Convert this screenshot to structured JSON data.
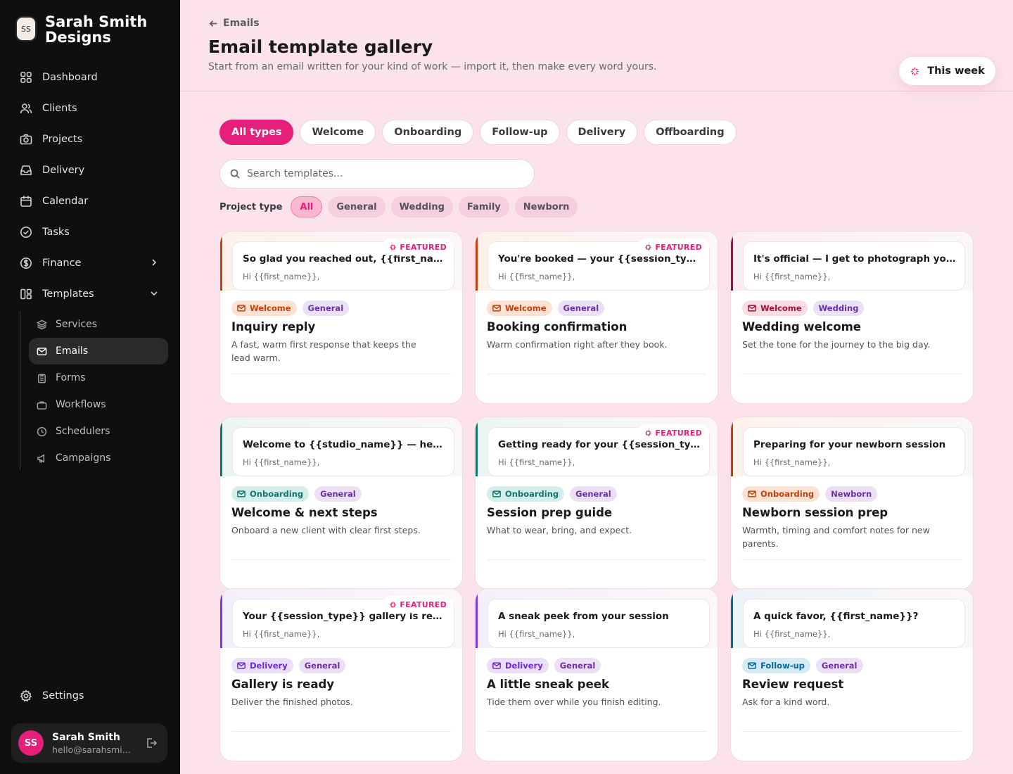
{
  "brand": {
    "initials": "SS",
    "name": "Sarah Smith Designs"
  },
  "nav": [
    {
      "label": "Dashboard",
      "icon": "grid-icon"
    },
    {
      "label": "Clients",
      "icon": "users-icon"
    },
    {
      "label": "Projects",
      "icon": "camera-icon"
    },
    {
      "label": "Delivery",
      "icon": "inbox-icon"
    },
    {
      "label": "Calendar",
      "icon": "calendar-icon"
    },
    {
      "label": "Tasks",
      "icon": "check-circle-icon"
    },
    {
      "label": "Finance",
      "icon": "dollar-icon"
    },
    {
      "label": "Templates",
      "icon": "layout-icon"
    }
  ],
  "subnav": [
    {
      "label": "Services",
      "icon": "layers-icon"
    },
    {
      "label": "Emails",
      "icon": "mail-icon"
    },
    {
      "label": "Forms",
      "icon": "clipboard-icon"
    },
    {
      "label": "Workflows",
      "icon": "briefcase-icon"
    },
    {
      "label": "Schedulers",
      "icon": "clock-icon"
    },
    {
      "label": "Campaigns",
      "icon": "megaphone-icon"
    }
  ],
  "settings": "Settings",
  "user": {
    "initials": "SS",
    "name": "Sarah Smith",
    "email": "hello@sarahsmi..."
  },
  "header": {
    "back": "Emails",
    "title": "Email template gallery",
    "subtitle": "Start from an email written for your kind of work — import it, then make every word yours.",
    "week_button": "This week"
  },
  "type_tabs": [
    "All types",
    "Welcome",
    "Onboarding",
    "Follow-up",
    "Delivery",
    "Offboarding"
  ],
  "search": {
    "placeholder": "Search templates..."
  },
  "project_type": {
    "label": "Project type",
    "chips": [
      "All",
      "General",
      "Wedding",
      "Family",
      "Newborn"
    ]
  },
  "featured_label": "FEATURED",
  "cards": [
    {
      "subject": "So glad you reached out, {{first_name}}!",
      "greeting": "Hi {{first_name}},",
      "featured": true,
      "type": "Welcome",
      "project": "General",
      "title": "Inquiry reply",
      "desc": "A fast, warm first response that keeps the lead warm.",
      "accent": "#c2410c",
      "tint": "#fdf1ea",
      "badge_bg": "#fde2d3",
      "badge_fg": "#c2410c"
    },
    {
      "subject": "You're booked — your {{session_type}} is confirmed",
      "greeting": "Hi {{first_name}},",
      "featured": true,
      "type": "Welcome",
      "project": "General",
      "title": "Booking confirmation",
      "desc": "Warm confirmation right after they book.",
      "accent": "#c2410c",
      "tint": "#fdf1ea",
      "badge_bg": "#fde2d3",
      "badge_fg": "#c2410c"
    },
    {
      "subject": "It's official — I get to photograph your wedding!",
      "greeting": "Hi {{first_name}},",
      "featured": false,
      "type": "Welcome",
      "project": "Wedding",
      "title": "Wedding welcome",
      "desc": "Set the tone for the journey to the big day.",
      "accent": "#9f1239",
      "tint": "#fbeef2",
      "badge_bg": "#fbdbe4",
      "badge_fg": "#9f1239"
    },
    {
      "subject": "Welcome to {{studio_name}} — here's what's next",
      "greeting": "Hi {{first_name}},",
      "featured": false,
      "type": "Onboarding",
      "project": "General",
      "title": "Welcome & next steps",
      "desc": "Onboard a new client with clear first steps.",
      "accent": "#0f766e",
      "tint": "#ecf5f3",
      "badge_bg": "#d4efe9",
      "badge_fg": "#0f766e"
    },
    {
      "subject": "Getting ready for your {{session_type}} session",
      "greeting": "Hi {{first_name}},",
      "featured": true,
      "type": "Onboarding",
      "project": "General",
      "title": "Session prep guide",
      "desc": "What to wear, bring, and expect.",
      "accent": "#0f766e",
      "tint": "#ecf5f3",
      "badge_bg": "#d4efe9",
      "badge_fg": "#0f766e"
    },
    {
      "subject": "Preparing for your newborn session",
      "greeting": "Hi {{first_name}},",
      "featured": false,
      "type": "Onboarding",
      "project": "Newborn",
      "title": "Newborn session prep",
      "desc": "Warmth, timing and comfort notes for new parents.",
      "accent": "#c2410c",
      "tint": "#fdf3ea",
      "badge_bg": "#fde2d3",
      "badge_fg": "#c2410c"
    },
    {
      "subject": "Your {{session_type}} gallery is ready",
      "greeting": "Hi {{first_name}},",
      "featured": true,
      "type": "Delivery",
      "project": "General",
      "title": "Gallery is ready",
      "desc": "Deliver the finished photos.",
      "accent": "#7c3aed",
      "tint": "#f4effc",
      "badge_bg": "#e9dffb",
      "badge_fg": "#6d28d9"
    },
    {
      "subject": "A sneak peek from your session",
      "greeting": "Hi {{first_name}},",
      "featured": false,
      "type": "Delivery",
      "project": "General",
      "title": "A little sneak peek",
      "desc": "Tide them over while you finish editing.",
      "accent": "#7c3aed",
      "tint": "#f4effc",
      "badge_bg": "#e9dffb",
      "badge_fg": "#6d28d9"
    },
    {
      "subject": "A quick favor, {{first_name}}?",
      "greeting": "Hi {{first_name}},",
      "featured": false,
      "type": "Follow-up",
      "project": "General",
      "title": "Review request",
      "desc": "Ask for a kind word.",
      "accent": "#0369a1",
      "tint": "#ecf3f8",
      "badge_bg": "#d6eaf6",
      "badge_fg": "#0369a1"
    }
  ]
}
